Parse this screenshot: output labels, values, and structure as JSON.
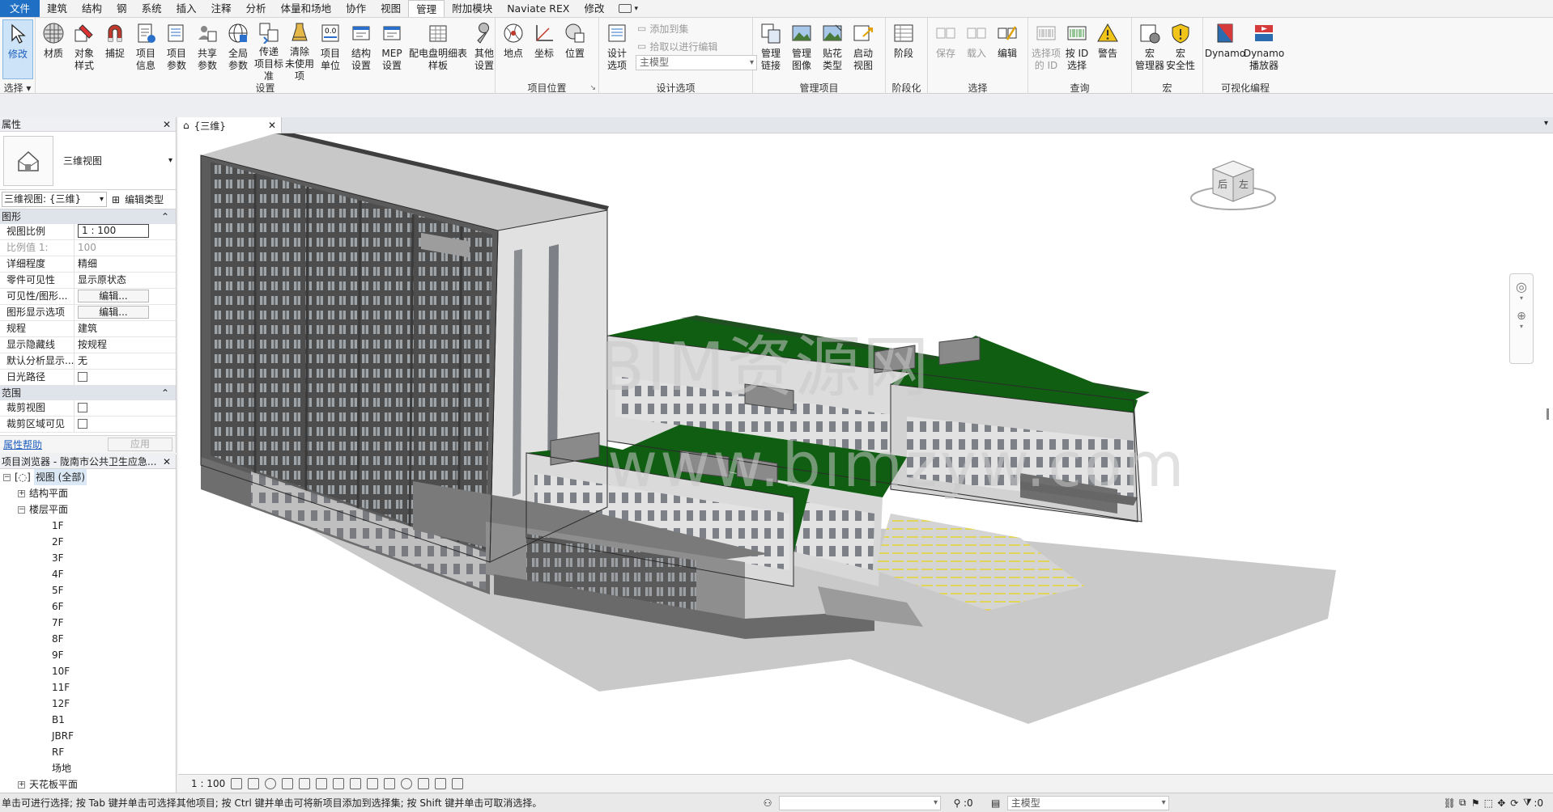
{
  "tabs": [
    "文件",
    "建筑",
    "结构",
    "钢",
    "系统",
    "插入",
    "注释",
    "分析",
    "体量和场地",
    "协作",
    "视图",
    "管理",
    "附加模块",
    "Naviate REX",
    "修改"
  ],
  "ribbon": {
    "select_panel": {
      "modify": "修改",
      "title": "选择"
    },
    "settings_panel": {
      "title": "设置",
      "buttons": [
        "材质",
        "对象\n样式",
        "捕捉",
        "项目\n信息",
        "项目\n参数",
        "共享\n参数",
        "全局\n参数",
        "传递\n项目标准",
        "清除\n未使用项",
        "项目\n单位",
        "结构\n设置",
        "MEP\n设置",
        "配电盘明细表\n样板",
        "其他\n设置"
      ]
    },
    "location_panel": {
      "title": "项目位置",
      "buttons": [
        "地点",
        "坐标",
        "位置"
      ]
    },
    "design_options_panel": {
      "title": "设计选项",
      "button": "设计\n选项",
      "add_to_set": "添加到集",
      "pick_to_edit": "拾取以进行编辑",
      "main_model": "主模型"
    },
    "manage_project_panel": {
      "title": "管理项目",
      "buttons": [
        "管理\n链接",
        "管理\n图像",
        "贴花\n类型",
        "启动\n视图"
      ]
    },
    "phasing_panel": {
      "title": "阶段化",
      "buttons": [
        "阶段"
      ]
    },
    "selection_panel": {
      "title": "选择",
      "buttons": [
        "保存",
        "载入",
        "编辑"
      ]
    },
    "inquiry_panel": {
      "title": "查询",
      "buttons": [
        "选择项\n的 ID",
        "按 ID\n选择",
        "警告"
      ]
    },
    "macros_panel": {
      "title": "宏",
      "buttons": [
        "宏\n管理器",
        "宏\n安全性"
      ]
    },
    "visual_programming_panel": {
      "title": "可视化编程",
      "buttons": [
        "Dynamo",
        "Dynamo\n播放器"
      ]
    }
  },
  "properties": {
    "title": "属性",
    "type_name": "三维视图",
    "view_selector": "三维视图: {三维}",
    "edit_type": "编辑类型",
    "group_graphics": "图形",
    "rows": [
      {
        "k": "视图比例",
        "v": "1 : 100"
      },
      {
        "k": "比例值 1:",
        "v": "100"
      },
      {
        "k": "详细程度",
        "v": "精细"
      },
      {
        "k": "零件可见性",
        "v": "显示原状态"
      },
      {
        "k": "可见性/图形...",
        "v": "编辑..."
      },
      {
        "k": "图形显示选项",
        "v": "编辑..."
      },
      {
        "k": "规程",
        "v": "建筑"
      },
      {
        "k": "显示隐藏线",
        "v": "按规程"
      },
      {
        "k": "默认分析显示...",
        "v": "无"
      },
      {
        "k": "日光路径",
        "v": ""
      }
    ],
    "group_extents": "范围",
    "extent_rows": [
      {
        "k": "裁剪视图",
        "v": ""
      },
      {
        "k": "裁剪区域可见",
        "v": ""
      }
    ],
    "help_link": "属性帮助",
    "apply": "应用"
  },
  "browser": {
    "title": "项目浏览器 - 陇南市公共卫生应急...",
    "root": "视图 (全部)",
    "structural_plans": "结构平面",
    "floor_plans": "楼层平面",
    "levels": [
      "1F",
      "2F",
      "3F",
      "4F",
      "5F",
      "6F",
      "7F",
      "8F",
      "9F",
      "10F",
      "11F",
      "12F",
      "B1",
      "JBRF",
      "RF",
      "场地"
    ],
    "ceiling_plans": "天花板平面"
  },
  "view": {
    "tab_label": "{三维}",
    "watermark_1": "BIM资源网",
    "watermark_2": "www.bimzyw.com",
    "viewcube_left": "左",
    "viewcube_back": "后"
  },
  "view_control": {
    "scale": "1 : 100"
  },
  "status": {
    "message": "单击可进行选择; 按 Tab 键并单击可选择其他项目; 按 Ctrl 键并单击可将新项目添加到选择集; 按 Shift 键并单击可取消选择。",
    "zero_a": ":0",
    "main_model": "主模型",
    "filter_count": ":0"
  },
  "colors": {
    "accent": "#1f6fc5",
    "roof_green": "#0f5e12",
    "facade_dark": "#5a5a5a"
  }
}
